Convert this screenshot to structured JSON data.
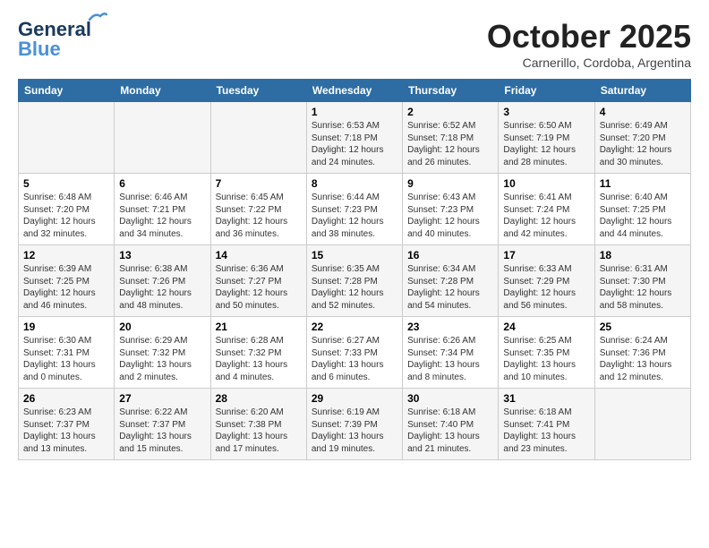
{
  "header": {
    "logo_line1": "General",
    "logo_line2": "Blue",
    "month": "October 2025",
    "location": "Carnerillo, Cordoba, Argentina"
  },
  "weekdays": [
    "Sunday",
    "Monday",
    "Tuesday",
    "Wednesday",
    "Thursday",
    "Friday",
    "Saturday"
  ],
  "weeks": [
    [
      {
        "day": "",
        "sunrise": "",
        "sunset": "",
        "daylight": ""
      },
      {
        "day": "",
        "sunrise": "",
        "sunset": "",
        "daylight": ""
      },
      {
        "day": "",
        "sunrise": "",
        "sunset": "",
        "daylight": ""
      },
      {
        "day": "1",
        "sunrise": "Sunrise: 6:53 AM",
        "sunset": "Sunset: 7:18 PM",
        "daylight": "Daylight: 12 hours and 24 minutes."
      },
      {
        "day": "2",
        "sunrise": "Sunrise: 6:52 AM",
        "sunset": "Sunset: 7:18 PM",
        "daylight": "Daylight: 12 hours and 26 minutes."
      },
      {
        "day": "3",
        "sunrise": "Sunrise: 6:50 AM",
        "sunset": "Sunset: 7:19 PM",
        "daylight": "Daylight: 12 hours and 28 minutes."
      },
      {
        "day": "4",
        "sunrise": "Sunrise: 6:49 AM",
        "sunset": "Sunset: 7:20 PM",
        "daylight": "Daylight: 12 hours and 30 minutes."
      }
    ],
    [
      {
        "day": "5",
        "sunrise": "Sunrise: 6:48 AM",
        "sunset": "Sunset: 7:20 PM",
        "daylight": "Daylight: 12 hours and 32 minutes."
      },
      {
        "day": "6",
        "sunrise": "Sunrise: 6:46 AM",
        "sunset": "Sunset: 7:21 PM",
        "daylight": "Daylight: 12 hours and 34 minutes."
      },
      {
        "day": "7",
        "sunrise": "Sunrise: 6:45 AM",
        "sunset": "Sunset: 7:22 PM",
        "daylight": "Daylight: 12 hours and 36 minutes."
      },
      {
        "day": "8",
        "sunrise": "Sunrise: 6:44 AM",
        "sunset": "Sunset: 7:23 PM",
        "daylight": "Daylight: 12 hours and 38 minutes."
      },
      {
        "day": "9",
        "sunrise": "Sunrise: 6:43 AM",
        "sunset": "Sunset: 7:23 PM",
        "daylight": "Daylight: 12 hours and 40 minutes."
      },
      {
        "day": "10",
        "sunrise": "Sunrise: 6:41 AM",
        "sunset": "Sunset: 7:24 PM",
        "daylight": "Daylight: 12 hours and 42 minutes."
      },
      {
        "day": "11",
        "sunrise": "Sunrise: 6:40 AM",
        "sunset": "Sunset: 7:25 PM",
        "daylight": "Daylight: 12 hours and 44 minutes."
      }
    ],
    [
      {
        "day": "12",
        "sunrise": "Sunrise: 6:39 AM",
        "sunset": "Sunset: 7:25 PM",
        "daylight": "Daylight: 12 hours and 46 minutes."
      },
      {
        "day": "13",
        "sunrise": "Sunrise: 6:38 AM",
        "sunset": "Sunset: 7:26 PM",
        "daylight": "Daylight: 12 hours and 48 minutes."
      },
      {
        "day": "14",
        "sunrise": "Sunrise: 6:36 AM",
        "sunset": "Sunset: 7:27 PM",
        "daylight": "Daylight: 12 hours and 50 minutes."
      },
      {
        "day": "15",
        "sunrise": "Sunrise: 6:35 AM",
        "sunset": "Sunset: 7:28 PM",
        "daylight": "Daylight: 12 hours and 52 minutes."
      },
      {
        "day": "16",
        "sunrise": "Sunrise: 6:34 AM",
        "sunset": "Sunset: 7:28 PM",
        "daylight": "Daylight: 12 hours and 54 minutes."
      },
      {
        "day": "17",
        "sunrise": "Sunrise: 6:33 AM",
        "sunset": "Sunset: 7:29 PM",
        "daylight": "Daylight: 12 hours and 56 minutes."
      },
      {
        "day": "18",
        "sunrise": "Sunrise: 6:31 AM",
        "sunset": "Sunset: 7:30 PM",
        "daylight": "Daylight: 12 hours and 58 minutes."
      }
    ],
    [
      {
        "day": "19",
        "sunrise": "Sunrise: 6:30 AM",
        "sunset": "Sunset: 7:31 PM",
        "daylight": "Daylight: 13 hours and 0 minutes."
      },
      {
        "day": "20",
        "sunrise": "Sunrise: 6:29 AM",
        "sunset": "Sunset: 7:32 PM",
        "daylight": "Daylight: 13 hours and 2 minutes."
      },
      {
        "day": "21",
        "sunrise": "Sunrise: 6:28 AM",
        "sunset": "Sunset: 7:32 PM",
        "daylight": "Daylight: 13 hours and 4 minutes."
      },
      {
        "day": "22",
        "sunrise": "Sunrise: 6:27 AM",
        "sunset": "Sunset: 7:33 PM",
        "daylight": "Daylight: 13 hours and 6 minutes."
      },
      {
        "day": "23",
        "sunrise": "Sunrise: 6:26 AM",
        "sunset": "Sunset: 7:34 PM",
        "daylight": "Daylight: 13 hours and 8 minutes."
      },
      {
        "day": "24",
        "sunrise": "Sunrise: 6:25 AM",
        "sunset": "Sunset: 7:35 PM",
        "daylight": "Daylight: 13 hours and 10 minutes."
      },
      {
        "day": "25",
        "sunrise": "Sunrise: 6:24 AM",
        "sunset": "Sunset: 7:36 PM",
        "daylight": "Daylight: 13 hours and 12 minutes."
      }
    ],
    [
      {
        "day": "26",
        "sunrise": "Sunrise: 6:23 AM",
        "sunset": "Sunset: 7:37 PM",
        "daylight": "Daylight: 13 hours and 13 minutes."
      },
      {
        "day": "27",
        "sunrise": "Sunrise: 6:22 AM",
        "sunset": "Sunset: 7:37 PM",
        "daylight": "Daylight: 13 hours and 15 minutes."
      },
      {
        "day": "28",
        "sunrise": "Sunrise: 6:20 AM",
        "sunset": "Sunset: 7:38 PM",
        "daylight": "Daylight: 13 hours and 17 minutes."
      },
      {
        "day": "29",
        "sunrise": "Sunrise: 6:19 AM",
        "sunset": "Sunset: 7:39 PM",
        "daylight": "Daylight: 13 hours and 19 minutes."
      },
      {
        "day": "30",
        "sunrise": "Sunrise: 6:18 AM",
        "sunset": "Sunset: 7:40 PM",
        "daylight": "Daylight: 13 hours and 21 minutes."
      },
      {
        "day": "31",
        "sunrise": "Sunrise: 6:18 AM",
        "sunset": "Sunset: 7:41 PM",
        "daylight": "Daylight: 13 hours and 23 minutes."
      },
      {
        "day": "",
        "sunrise": "",
        "sunset": "",
        "daylight": ""
      }
    ]
  ]
}
